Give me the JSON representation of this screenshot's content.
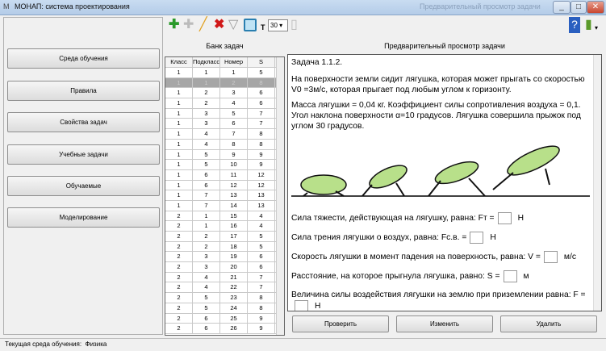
{
  "window": {
    "title": "МОНАП: система проектирования",
    "ghost_title": "Предварительный просмотр задачи",
    "minimize": "_",
    "maximize": "□",
    "close": "✕"
  },
  "sidebar": {
    "items": [
      {
        "label": "Среда обучения"
      },
      {
        "label": "Правила"
      },
      {
        "label": "Свойства задач"
      },
      {
        "label": "Учебные задачи"
      },
      {
        "label": "Обучаемые"
      },
      {
        "label": "Моделирование"
      }
    ]
  },
  "toolbar": {
    "font_label": "T",
    "font_size": "30"
  },
  "bank": {
    "title": "Банк задач",
    "columns": [
      "Класс",
      "Подкласс",
      "Номер",
      "S"
    ],
    "rows": [
      [
        "1",
        "1",
        "1",
        "5"
      ],
      [
        "1",
        "1",
        "2",
        "8"
      ],
      [
        "1",
        "2",
        "3",
        "6"
      ],
      [
        "1",
        "2",
        "4",
        "6"
      ],
      [
        "1",
        "3",
        "5",
        "7"
      ],
      [
        "1",
        "3",
        "6",
        "7"
      ],
      [
        "1",
        "4",
        "7",
        "8"
      ],
      [
        "1",
        "4",
        "8",
        "8"
      ],
      [
        "1",
        "5",
        "9",
        "9"
      ],
      [
        "1",
        "5",
        "10",
        "9"
      ],
      [
        "1",
        "6",
        "11",
        "12"
      ],
      [
        "1",
        "6",
        "12",
        "12"
      ],
      [
        "1",
        "7",
        "13",
        "13"
      ],
      [
        "1",
        "7",
        "14",
        "13"
      ],
      [
        "2",
        "1",
        "15",
        "4"
      ],
      [
        "2",
        "1",
        "16",
        "4"
      ],
      [
        "2",
        "2",
        "17",
        "5"
      ],
      [
        "2",
        "2",
        "18",
        "5"
      ],
      [
        "2",
        "3",
        "19",
        "6"
      ],
      [
        "2",
        "3",
        "20",
        "6"
      ],
      [
        "2",
        "4",
        "21",
        "7"
      ],
      [
        "2",
        "4",
        "22",
        "7"
      ],
      [
        "2",
        "5",
        "23",
        "8"
      ],
      [
        "2",
        "5",
        "24",
        "8"
      ],
      [
        "2",
        "6",
        "25",
        "9"
      ],
      [
        "2",
        "6",
        "26",
        "9"
      ]
    ],
    "selected_index": 1
  },
  "preview": {
    "title": "Предварительный просмотр задачи",
    "heading": "Задача 1.1.2.",
    "p1": "На поверхности земли сидит лягушка, которая может прыгать со скоростью V0 =3м/с, которая прыгает под любым углом к горизонту.",
    "p2": "Масса лягушки = 0,04 кг. Коэффициент силы сопротивления воздуха = 0,1. Угол наклона поверхности α=10 градусов. Лягушка совершила прыжок под углом 30 градусов.",
    "questions": [
      {
        "text": "Сила тяжести, действующая на лягушку, равна: Fт =",
        "unit": "Н"
      },
      {
        "text": "Сила трения лягушки о воздух, равна: Fс.в. =",
        "unit": "Н"
      },
      {
        "text": "Скорость лягушки в момент падения на поверхность, равна: V =",
        "unit": "м/с"
      },
      {
        "text": "Расстояние, на которое прыгнула лягушка, равно: S =",
        "unit": "м"
      },
      {
        "text": "Величина силы воздействия лягушки на землю при приземлении равна: F =",
        "unit": "Н"
      }
    ]
  },
  "actions": {
    "check": "Проверить",
    "edit": "Изменить",
    "delete": "Удалить"
  },
  "status": {
    "label": "Текущая среда обучения:",
    "value": "Физика"
  }
}
